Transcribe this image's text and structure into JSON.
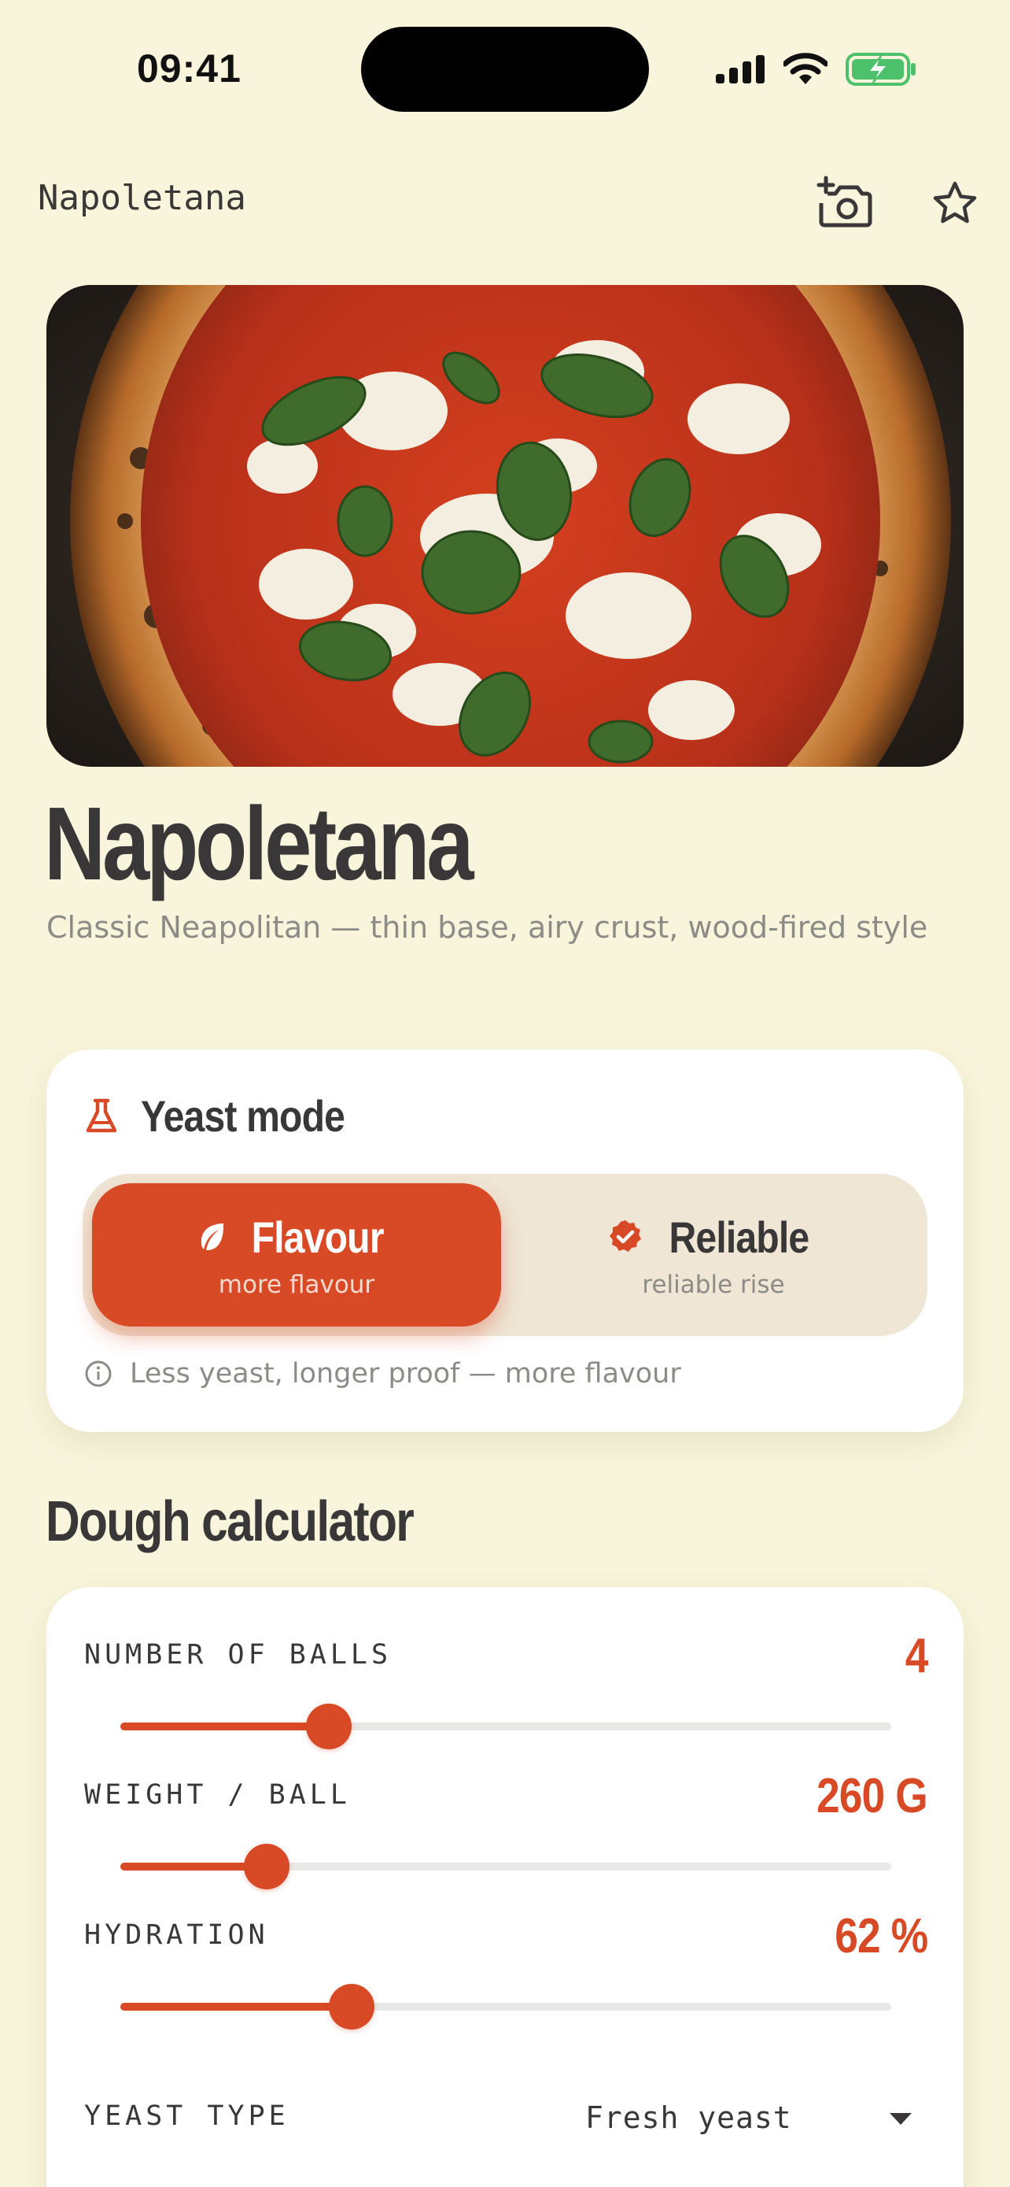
{
  "status_bar": {
    "time": "09:41"
  },
  "topbar": {
    "title": "Napoletana",
    "camera_icon": "camera-add-icon",
    "favorite_icon": "star-outline-icon"
  },
  "recipe": {
    "title": "Napoletana",
    "subtitle": "Classic Neapolitan — thin base, airy crust, wood-fired style"
  },
  "yeast_mode": {
    "title": "Yeast mode",
    "options": [
      {
        "label": "Flavour",
        "sub": "more flavour",
        "selected": true,
        "icon": "leaf-icon"
      },
      {
        "label": "Reliable",
        "sub": "reliable rise",
        "selected": false,
        "icon": "verified-badge-icon"
      }
    ],
    "hint": "Less yeast, longer proof — more flavour"
  },
  "calculator": {
    "title": "Dough calculator",
    "rows": [
      {
        "label": "NUMBER OF BALLS",
        "value": "4",
        "fraction": 0.27
      },
      {
        "label": "WEIGHT / BALL",
        "value": "260 G",
        "fraction": 0.19
      },
      {
        "label": "HYDRATION",
        "value": "62 %",
        "fraction": 0.3
      }
    ],
    "yeast_type": {
      "label": "YEAST TYPE",
      "value": "Fresh yeast"
    }
  },
  "colors": {
    "accent": "#d74a25",
    "background": "#f8f5dc",
    "text": "#393737",
    "muted": "#8d8b86"
  }
}
